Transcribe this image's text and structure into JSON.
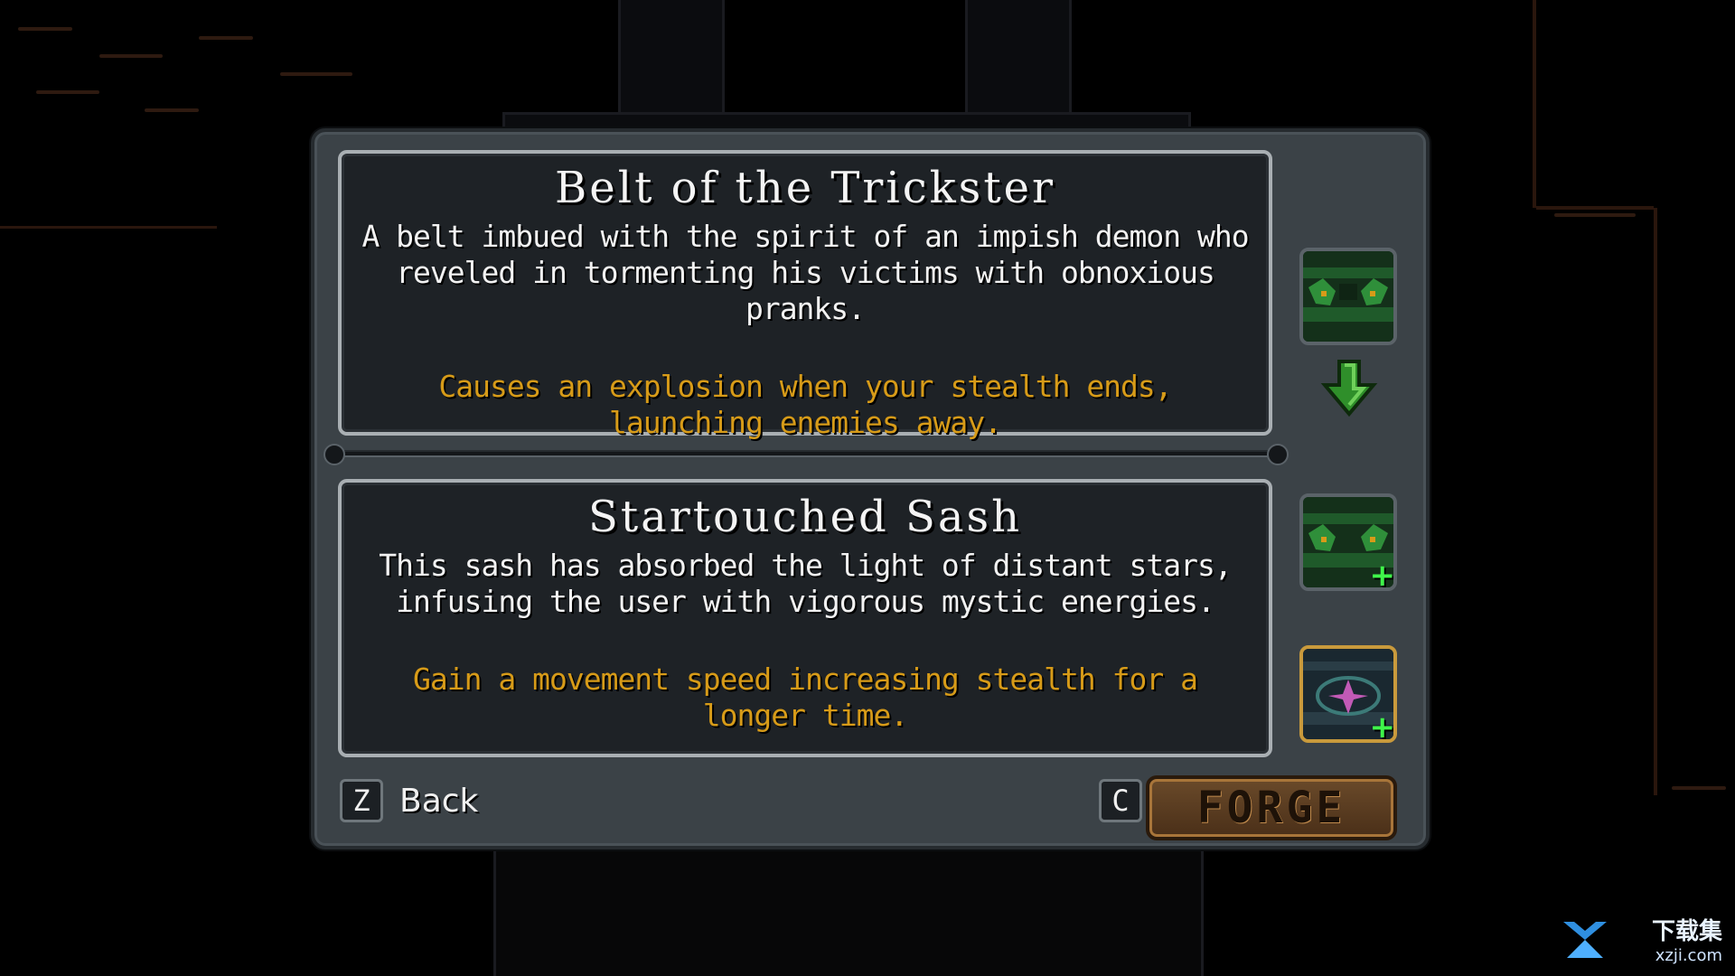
{
  "item_current": {
    "name": "Belt of the Trickster",
    "description": "A belt imbued with the spirit of an impish demon who reveled in tormenting his victims with obnoxious pranks.",
    "effect": "Causes an explosion when your stealth ends, launching enemies away."
  },
  "item_new": {
    "name": "Startouched Sash",
    "description": "This sash has absorbed the light of distant stars, infusing the user with vigorous mystic energies.",
    "effect": "Gain a movement speed increasing stealth for a longer time."
  },
  "controls": {
    "back_key": "Z",
    "back_label": "Back",
    "forge_key": "C",
    "forge_label": "FORGE"
  },
  "watermark": {
    "top": "下载集",
    "bottom": "xzji.com"
  },
  "colors": {
    "effect_text": "#d79b18",
    "plus": "#3ff54a",
    "arrow": "#2f8f2a"
  }
}
